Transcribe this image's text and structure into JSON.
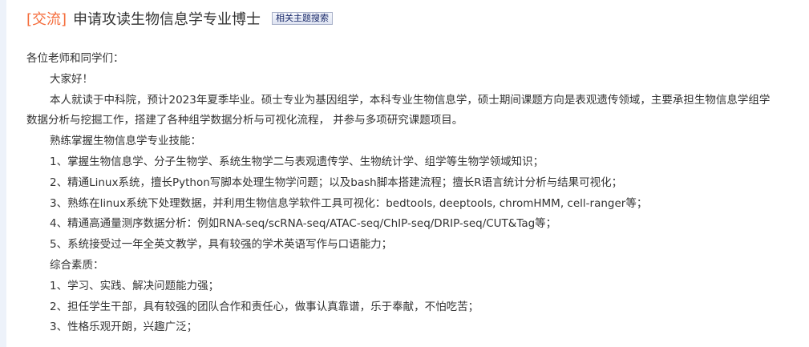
{
  "post": {
    "tag": "[交流]",
    "title": "申请攻读生物信息学专业博士",
    "search_button": "相关主题搜索"
  },
  "body": {
    "greeting": "各位老师和同学们：",
    "hello": "大家好！",
    "intro_line1": "本人就读于中科院，预计2023年夏季毕业。硕士专业为基因组学，本科专业生物信息学，硕士期间课题方向是表观遗传领域，主要承担生物信息学组学",
    "intro_line2": "数据分析与挖掘工作，搭建了各种组学数据分析与可视化流程， 并参与多项研究课题项目。",
    "skills_heading": "熟练掌握生物信息学专业技能：",
    "skills": [
      "1、掌握生物信息学、分子生物学、系统生物学二与表观遗传学、生物统计学、组学等生物学领域知识；",
      "2、精通Linux系统，擅长Python写脚本处理生物学问题；以及bash脚本搭建流程；擅长R语言统计分析与结果可视化；",
      "3、熟练在linux系统下处理数据，并利用生物信息学软件工具可视化：bedtools, deeptools, chromHMM, cell-ranger等；",
      "4、精通高通量测序数据分析：例如RNA-seq/scRNA-seq/ATAC-seq/ChIP-seq/DRIP-seq/CUT&Tag等；",
      "5、系统接受过一年全英文教学，具有较强的学术英语写作与口语能力；"
    ],
    "qualities_heading": "综合素质：",
    "qualities": [
      "1、学习、实践、解决问题能力强；",
      "2、担任学生干部，具有较强的团队合作和责任心，做事认真靠谱，乐于奉献，不怕吃苦；",
      "3、性格乐观开朗，兴趣广泛；"
    ]
  }
}
